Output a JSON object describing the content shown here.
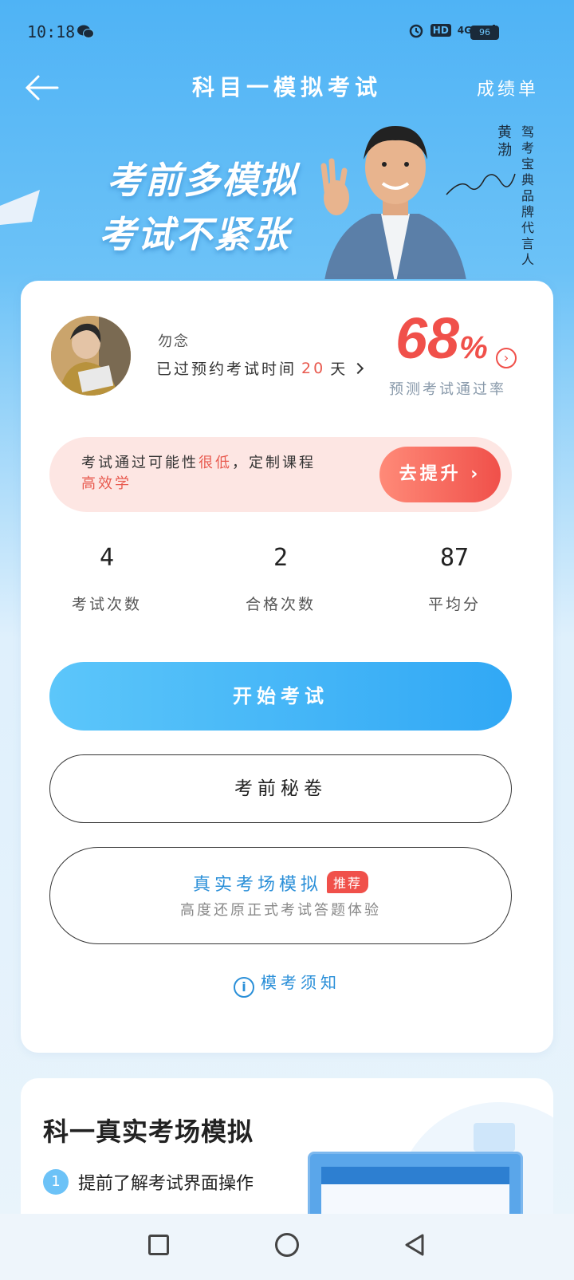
{
  "status_bar": {
    "time": "10:18",
    "hd": "HD",
    "network": "4G",
    "battery": "96"
  },
  "header": {
    "title": "科目一模拟考试",
    "report_link": "成绩单"
  },
  "banner": {
    "slogan_line1": "考前多模拟",
    "slogan_line2": "考试不紧张",
    "endorser_name": "黄渤",
    "endorser_desc": "驾考宝典品牌代言人"
  },
  "profile": {
    "name": "勿念",
    "exam_prefix": "已过预约考试时间",
    "days": "20",
    "days_unit": "天",
    "pass_rate_value": "68",
    "pass_rate_unit": "%",
    "pass_rate_label": "预测考试通过率"
  },
  "promo": {
    "text_prefix": "考试通过可能性",
    "text_highlight": "很低",
    "text_suffix": "，定制课程",
    "text_line2": "高效学",
    "button_label": "去提升"
  },
  "stats": [
    {
      "value": "4",
      "label": "考试次数"
    },
    {
      "value": "2",
      "label": "合格次数"
    },
    {
      "value": "87",
      "label": "平均分"
    }
  ],
  "actions": {
    "start_exam": "开始考试",
    "secret_paper": "考前秘卷",
    "real_sim_title": "真实考场模拟",
    "real_sim_badge": "推荐",
    "real_sim_subtitle": "高度还原正式考试答题体验",
    "notice": "模考须知"
  },
  "sim_section": {
    "title": "科一真实考场模拟",
    "items": [
      {
        "num": "1",
        "text": "提前了解考试界面操作"
      }
    ]
  },
  "colors": {
    "accent_blue": "#31a8f5",
    "accent_red": "#f0504a",
    "promo_bg": "#fde6e3"
  }
}
